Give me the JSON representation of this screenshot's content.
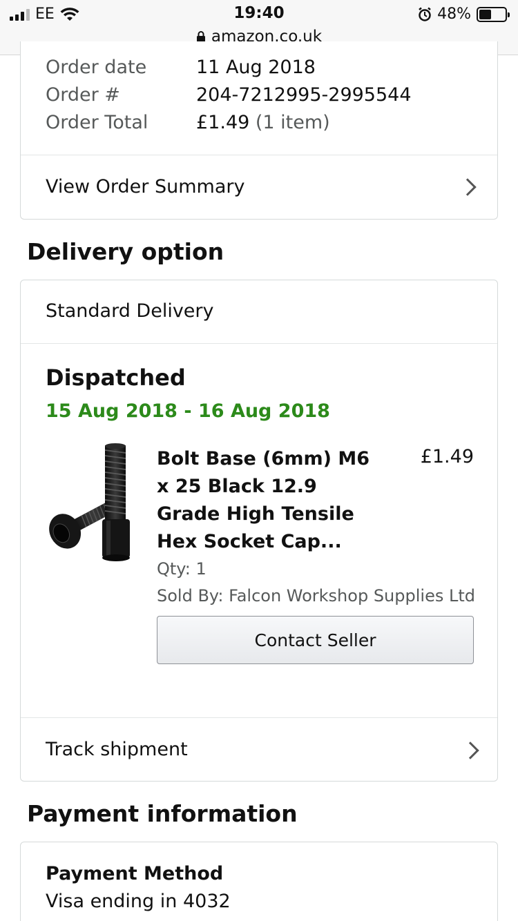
{
  "status_bar": {
    "carrier": "EE",
    "time": "19:40",
    "battery": "48%",
    "battery_level": 0.48,
    "url": "amazon.co.uk"
  },
  "order_summary": {
    "rows": [
      {
        "label": "Order date",
        "value": "11 Aug 2018",
        "sub": ""
      },
      {
        "label": "Order #",
        "value": "204-7212995-2995544",
        "sub": ""
      },
      {
        "label": "Order Total",
        "value": "£1.49",
        "sub": "(1 item)"
      }
    ],
    "view_summary_label": "View Order Summary"
  },
  "delivery": {
    "title": "Delivery option",
    "method": "Standard Delivery",
    "status": "Dispatched",
    "date_range": "15 Aug 2018 - 16 Aug 2018",
    "status_color": "#2c8a1a",
    "item": {
      "title": "Bolt Base (6mm) M6 x 25 Black 12.9 Grade High Tensile Hex Socket Cap...",
      "title_lines": [
        "Bolt Base (6mm) M6",
        "x 25 Black 12.9",
        "Grade High Tensile",
        "Hex Socket Cap..."
      ],
      "price": "£1.49",
      "qty": "Qty: 1",
      "sold_by": "Sold By: Falcon Workshop Supplies Ltd",
      "contact_button": "Contact Seller",
      "image_icon": "hex-socket-bolt-image"
    },
    "track_label": "Track shipment"
  },
  "payment": {
    "title": "Payment information",
    "method_label": "Payment Method",
    "method_value": "Visa ending in 4032"
  }
}
